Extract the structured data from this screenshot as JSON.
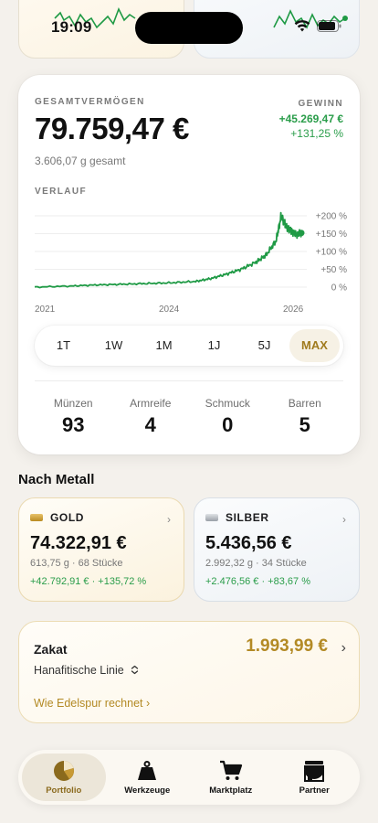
{
  "status": {
    "time": "19:09"
  },
  "summary": {
    "total_label": "GESAMTVERMÖGEN",
    "total_value": "79.759,47 €",
    "grams_total": "3.606,07 g gesamt",
    "gain_label": "GEWINN",
    "gain_abs": "+45.269,47 €",
    "gain_pct": "+131,25 %"
  },
  "history": {
    "label": "VERLAUF",
    "x_ticks": [
      "2021",
      "2024",
      "2026"
    ],
    "y_ticks": [
      "+200 %",
      "+150 %",
      "+100 %",
      "+50 %",
      "0 %"
    ]
  },
  "chart_data": {
    "type": "line",
    "x": [
      2020.8,
      2021.5,
      2022.0,
      2022.5,
      2023.0,
      2023.5,
      2024.0,
      2024.3,
      2024.6,
      2024.9,
      2025.2,
      2025.4,
      2025.6,
      2025.7,
      2025.8,
      2025.9,
      2026.0,
      2026.1
    ],
    "y": [
      0,
      3,
      6,
      8,
      10,
      12,
      16,
      24,
      36,
      50,
      70,
      90,
      130,
      200,
      170,
      158,
      148,
      152
    ],
    "ylim": [
      0,
      200
    ],
    "xlabel": "",
    "ylabel": ""
  },
  "ranges": {
    "items": [
      "1T",
      "1W",
      "1M",
      "1J",
      "5J",
      "MAX"
    ],
    "active": "MAX"
  },
  "counts": [
    {
      "label": "Münzen",
      "value": "93"
    },
    {
      "label": "Armreife",
      "value": "4"
    },
    {
      "label": "Schmuck",
      "value": "0"
    },
    {
      "label": "Barren",
      "value": "5"
    }
  ],
  "by_metal": {
    "title": "Nach Metall",
    "gold": {
      "name": "GOLD",
      "value": "74.322,91 €",
      "sub": "613,75 g · 68 Stücke",
      "gain": "+42.792,91 € · +135,72 %"
    },
    "silver": {
      "name": "SILBER",
      "value": "5.436,56 €",
      "sub": "2.992,32 g · 34 Stücke",
      "gain": "+2.476,56 € · +83,67 %"
    }
  },
  "zakat": {
    "title": "Zakat",
    "value": "1.993,99 €",
    "method": "Hanafitische Linie",
    "link": "Wie Edelspur rechnet"
  },
  "tabs": [
    {
      "label": "Portfolio",
      "icon": "pie-chart-icon"
    },
    {
      "label": "Werkzeuge",
      "icon": "weight-icon"
    },
    {
      "label": "Marktplatz",
      "icon": "cart-icon"
    },
    {
      "label": "Partner",
      "icon": "store-icon"
    }
  ],
  "colors": {
    "accent_gold": "#b38a25",
    "positive": "#2a9d4a"
  }
}
